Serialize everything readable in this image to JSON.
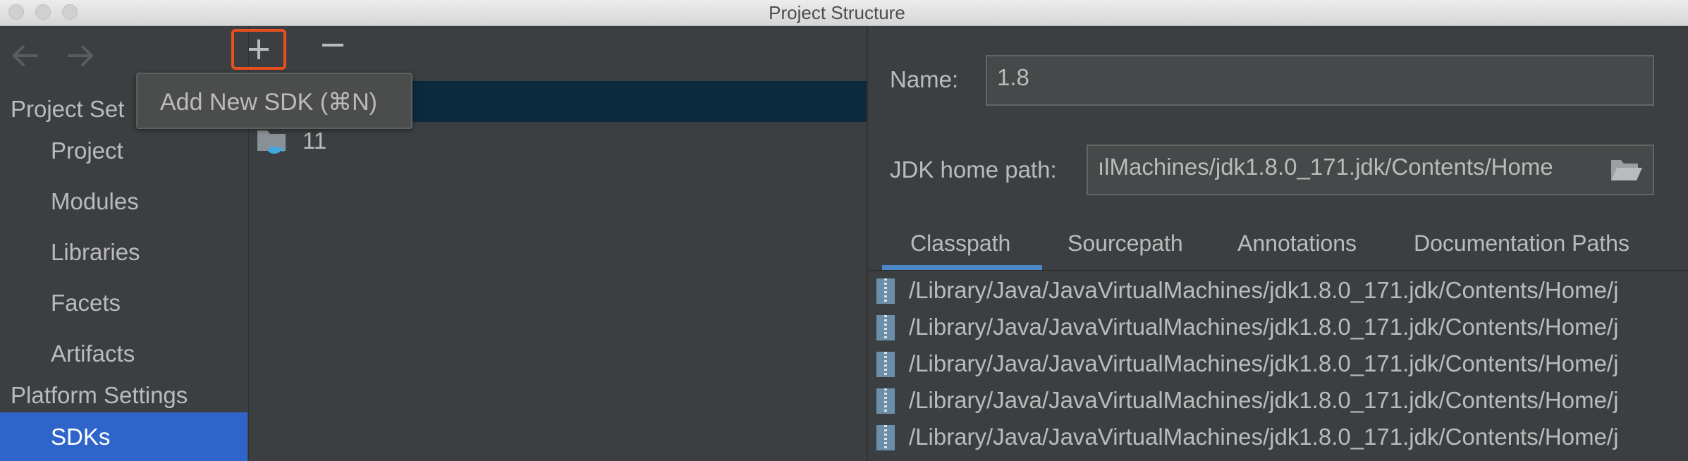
{
  "window": {
    "title": "Project Structure"
  },
  "sidebar": {
    "project_settings_label": "Project Set",
    "items": [
      {
        "label": "Project"
      },
      {
        "label": "Modules"
      },
      {
        "label": "Libraries"
      },
      {
        "label": "Facets"
      },
      {
        "label": "Artifacts"
      }
    ],
    "platform_settings_label": "Platform Settings",
    "sdks_label": "SDKs"
  },
  "toolbar": {
    "tooltip": "Add New SDK (⌘N)"
  },
  "sdk_list": {
    "items": [
      {
        "label": "11"
      }
    ]
  },
  "detail": {
    "name_label": "Name:",
    "name_value": "1.8",
    "jdk_home_label": "JDK home path:",
    "jdk_home_value": "ılMachines/jdk1.8.0_171.jdk/Contents/Home",
    "tabs": [
      {
        "label": "Classpath"
      },
      {
        "label": "Sourcepath"
      },
      {
        "label": "Annotations"
      },
      {
        "label": "Documentation Paths"
      }
    ],
    "classpath": [
      "/Library/Java/JavaVirtualMachines/jdk1.8.0_171.jdk/Contents/Home/j",
      "/Library/Java/JavaVirtualMachines/jdk1.8.0_171.jdk/Contents/Home/j",
      "/Library/Java/JavaVirtualMachines/jdk1.8.0_171.jdk/Contents/Home/j",
      "/Library/Java/JavaVirtualMachines/jdk1.8.0_171.jdk/Contents/Home/j",
      "/Library/Java/JavaVirtualMachines/jdk1.8.0_171.jdk/Contents/Home/j"
    ]
  },
  "colors": {
    "background": "#3c3f41",
    "selection": "#2f65ca",
    "list_selection": "#0d293e",
    "highlight_border": "#e8501e",
    "tab_underline": "#4a88c7"
  }
}
